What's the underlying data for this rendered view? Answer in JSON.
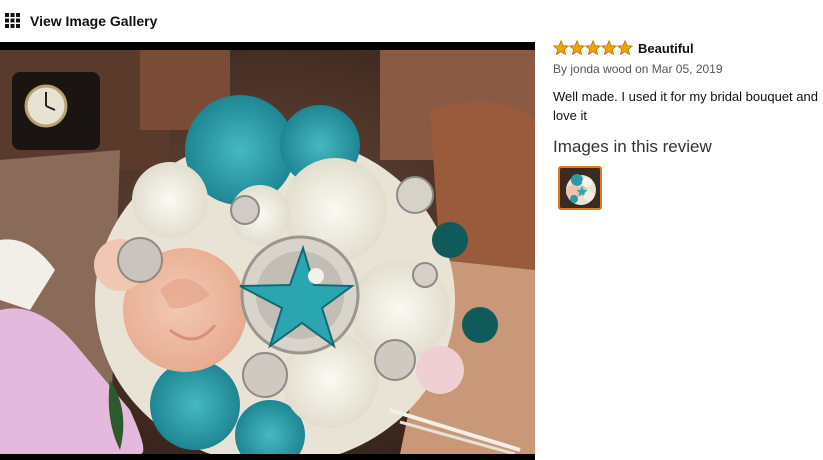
{
  "header": {
    "gallery_icon": "grid-icon",
    "gallery_link": "View Image Gallery"
  },
  "review": {
    "rating": 5,
    "rating_max": 5,
    "star_color": "#f0a30a",
    "title": "Beautiful",
    "byline_prefix": "By",
    "author": "jonda wood",
    "byline_on": "on",
    "date": "Mar 05, 2019",
    "body": "Well made. I used it for my bridal bouquet and love it",
    "images_heading": "Images in this review",
    "thumbnail_border_color": "#e47911"
  }
}
